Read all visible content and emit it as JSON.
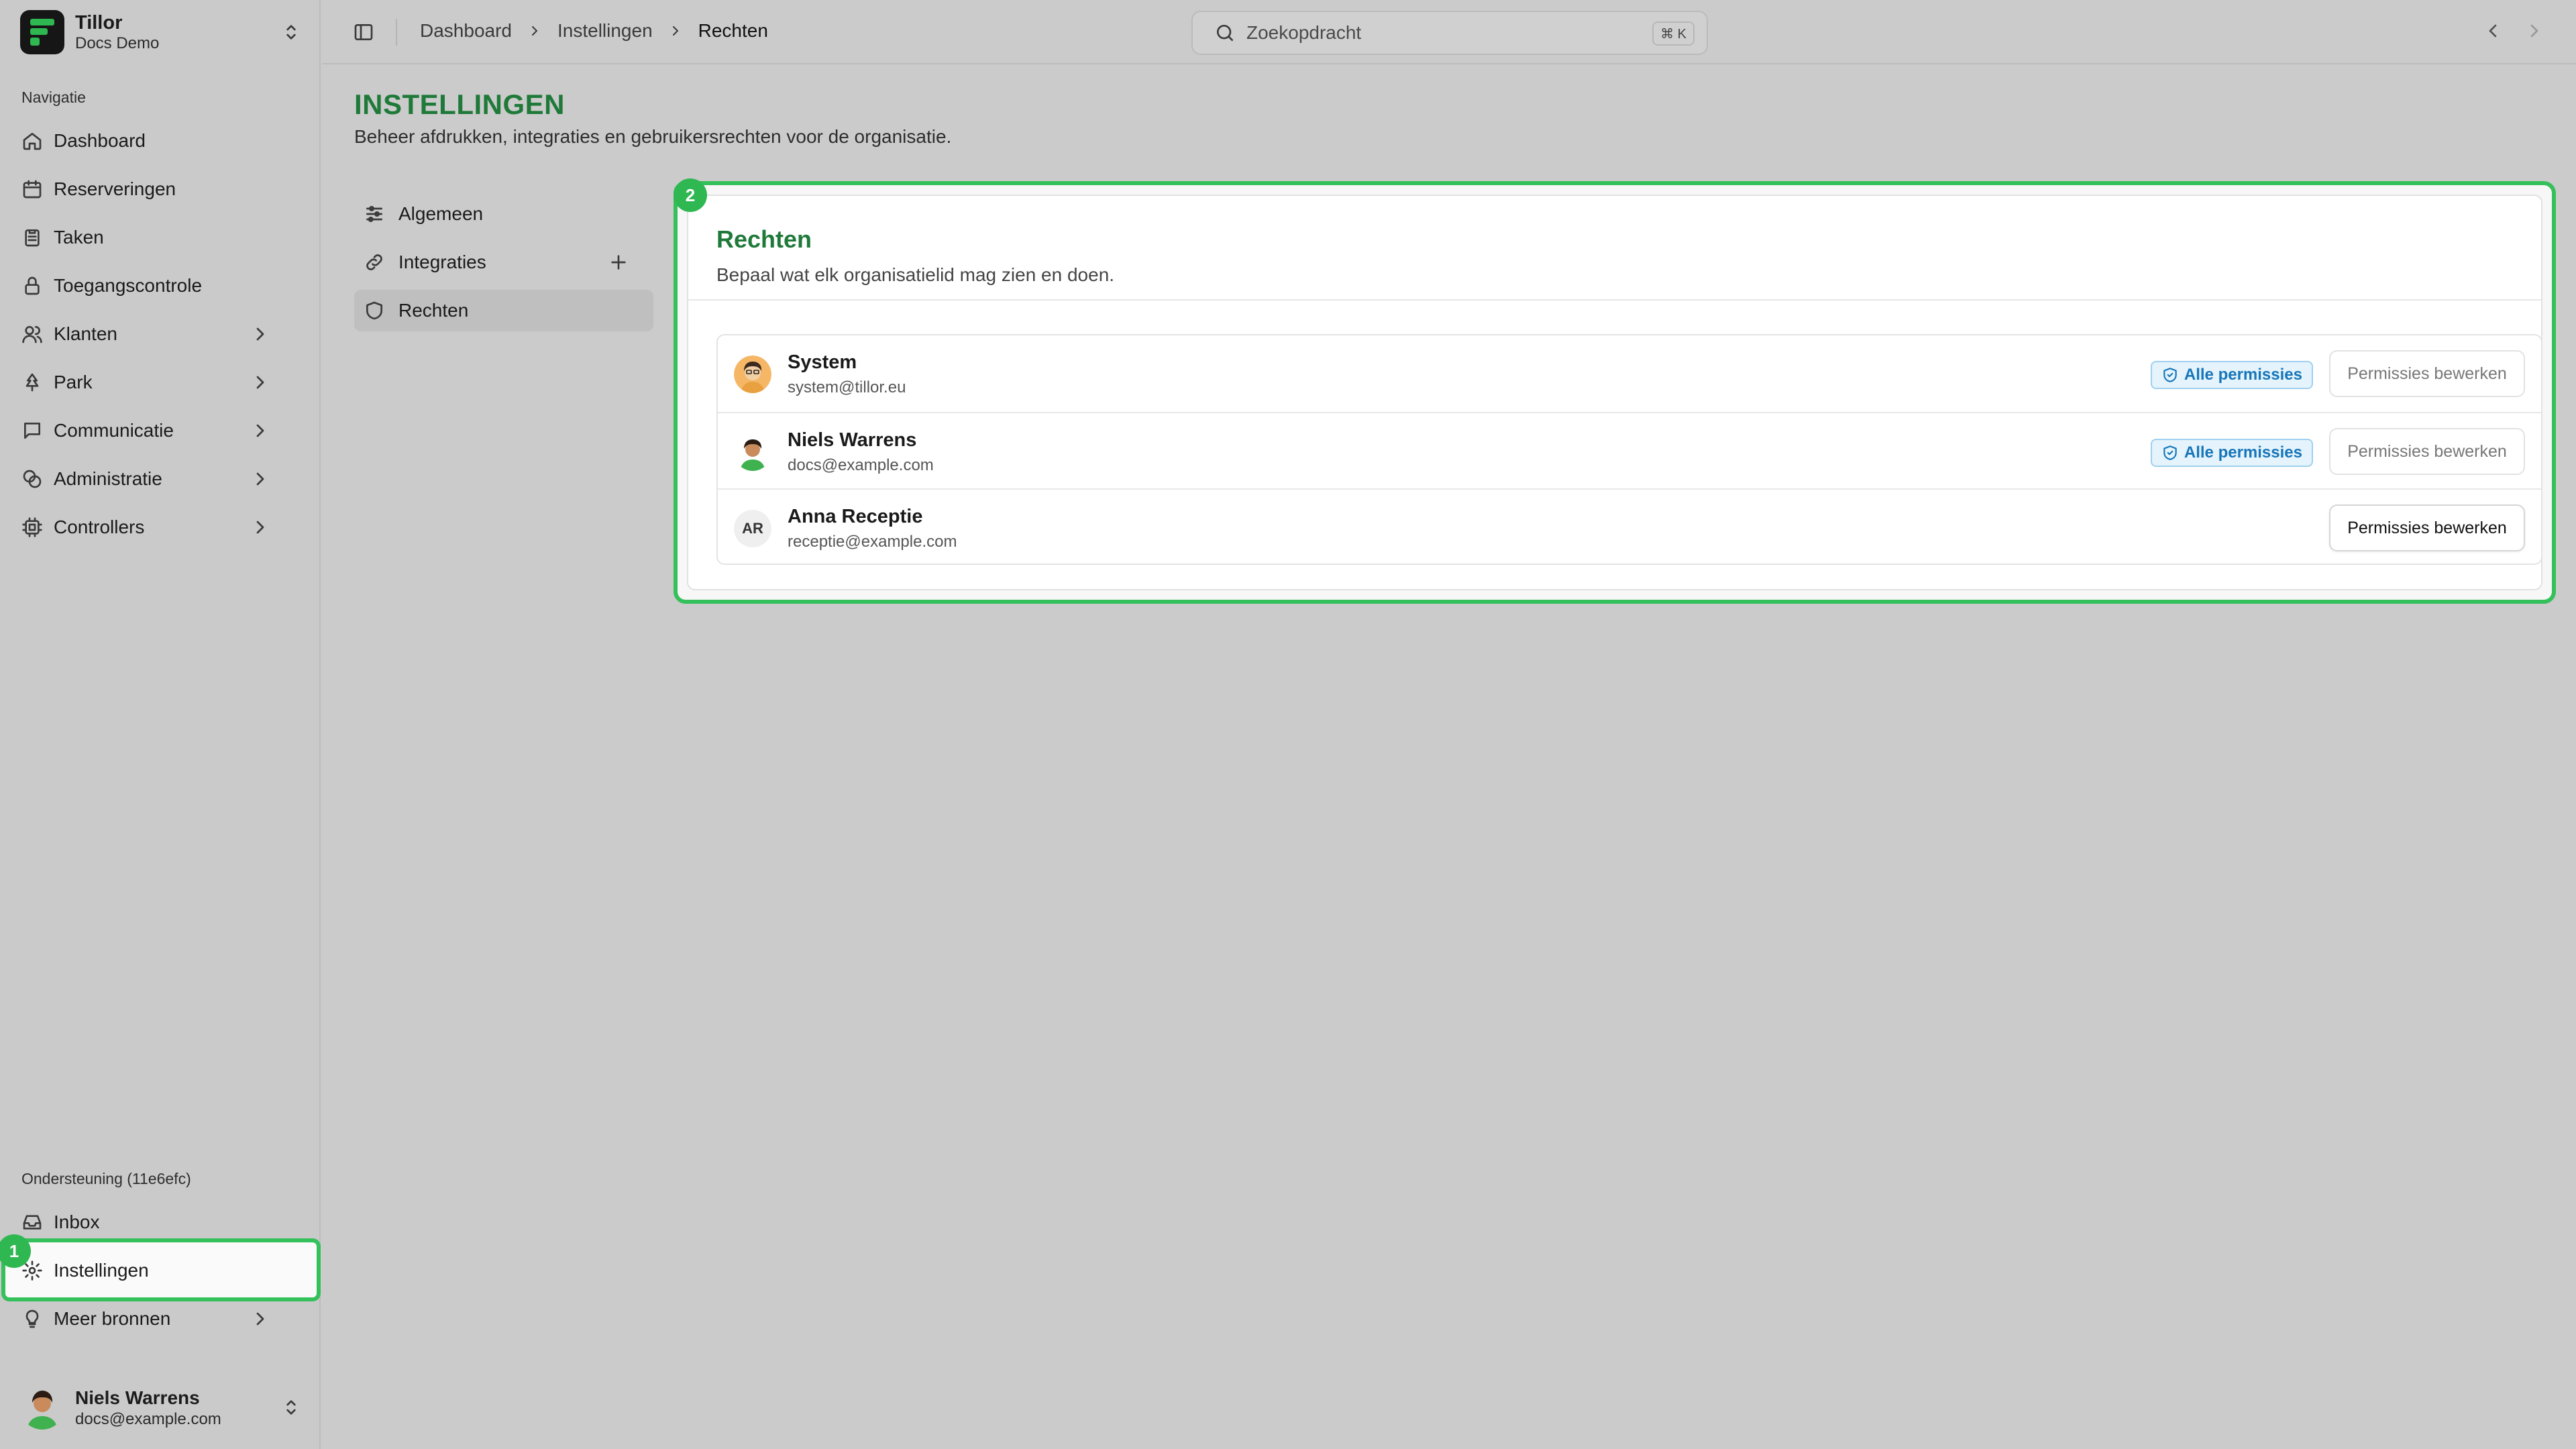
{
  "brand": {
    "name": "Tillor",
    "org": "Docs Demo"
  },
  "sidebar": {
    "nav_label": "Navigatie",
    "items": [
      {
        "label": "Dashboard"
      },
      {
        "label": "Reserveringen"
      },
      {
        "label": "Taken"
      },
      {
        "label": "Toegangscontrole"
      },
      {
        "label": "Klanten"
      },
      {
        "label": "Park"
      },
      {
        "label": "Communicatie"
      },
      {
        "label": "Administratie"
      },
      {
        "label": "Controllers"
      }
    ],
    "support_label": "Ondersteuning (11e6efc)",
    "support_items": [
      {
        "label": "Inbox"
      },
      {
        "label": "Instellingen"
      },
      {
        "label": "Meer bronnen"
      }
    ],
    "user": {
      "name": "Niels Warrens",
      "email": "docs@example.com"
    }
  },
  "topbar": {
    "breadcrumb": [
      "Dashboard",
      "Instellingen",
      "Rechten"
    ],
    "search_placeholder": "Zoekopdracht",
    "search_shortcut": "⌘ K"
  },
  "page": {
    "title": "INSTELLINGEN",
    "subtitle": "Beheer afdrukken, integraties en gebruikersrechten voor de organisatie."
  },
  "subnav": [
    {
      "label": "Algemeen"
    },
    {
      "label": "Integraties"
    },
    {
      "label": "Rechten"
    }
  ],
  "annotations": {
    "badge1": "1",
    "badge2": "2",
    "highlight_color": "#34c05a"
  },
  "rights": {
    "title": "Rechten",
    "description": "Bepaal wat elk organisatielid mag zien en doen.",
    "members": [
      {
        "name": "System",
        "email": "system@tillor.eu",
        "badge": "Alle permissies",
        "action": "Permissies bewerken"
      },
      {
        "name": "Niels Warrens",
        "email": "docs@example.com",
        "badge": "Alle permissies",
        "action": "Permissies bewerken"
      },
      {
        "name": "Anna Receptie",
        "email": "receptie@example.com",
        "initials": "AR",
        "action": "Permissies bewerken"
      }
    ]
  }
}
